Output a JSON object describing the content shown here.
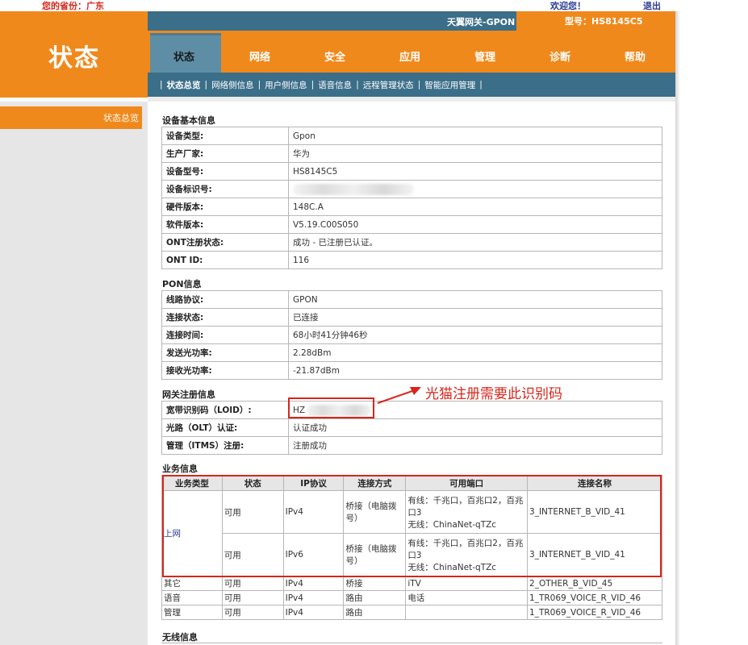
{
  "top": {
    "province_label": "您的省份：广东",
    "welcome": "欢迎您！",
    "logout": "退出"
  },
  "header": {
    "big_title": "状态",
    "gateway_name": "天翼网关-GPON",
    "model": "型号：HS8145C5"
  },
  "nav": {
    "tabs": [
      "状态",
      "网络",
      "安全",
      "应用",
      "管理",
      "诊断",
      "帮助"
    ],
    "active": "状态"
  },
  "subnav": {
    "items": [
      "状态总览",
      "网络侧信息",
      "用户侧信息",
      "语音信息",
      "远程管理状态",
      "智能应用管理"
    ],
    "active": "状态总览"
  },
  "sidebar": {
    "active_item": "状态总览"
  },
  "device": {
    "title": "设备基本信息",
    "rows": [
      {
        "k": "设备类型:",
        "v": "Gpon"
      },
      {
        "k": "生产厂家:",
        "v": "华为"
      },
      {
        "k": "设备型号:",
        "v": "HS8145C5"
      },
      {
        "k": "设备标识号:",
        "v": ""
      },
      {
        "k": "硬件版本:",
        "v": "148C.A"
      },
      {
        "k": "软件版本:",
        "v": "V5.19.C00S050"
      },
      {
        "k": "ONT注册状态:",
        "v": "成功 - 已注册已认证。"
      },
      {
        "k": "ONT ID:",
        "v": "116"
      }
    ]
  },
  "pon": {
    "title": "PON信息",
    "rows": [
      {
        "k": "线路协议:",
        "v": "GPON"
      },
      {
        "k": "连接状态:",
        "v": "已连接"
      },
      {
        "k": "连接时间:",
        "v": "68小时41分钟46秒"
      },
      {
        "k": "发送光功率:",
        "v": "2.28dBm"
      },
      {
        "k": "接收光功率:",
        "v": "-21.87dBm"
      }
    ]
  },
  "gw": {
    "title": "网关注册信息",
    "rows": [
      {
        "k": "宽带识别码（LOID）:",
        "v": "HZ"
      },
      {
        "k": "光路（OLT）认证:",
        "v": "认证成功"
      },
      {
        "k": "管理（ITMS）注册:",
        "v": "注册成功"
      }
    ],
    "annotation": "光猫注册需要此识别码"
  },
  "service": {
    "title": "业务信息",
    "headers": [
      "业务类型",
      "状态",
      "IP协议",
      "连接方式",
      "可用端口",
      "连接名称"
    ],
    "internet_label": "上网",
    "internet_rows": [
      {
        "status": "可用",
        "ip": "IPv4",
        "mode": "桥接（电脑拨号）",
        "port1": "有线：千兆口，百兆口2，百兆口3",
        "port2": "无线：ChinaNet-qTZc",
        "name": "3_INTERNET_B_VID_41"
      },
      {
        "status": "可用",
        "ip": "IPv6",
        "mode": "桥接（电脑拨号）",
        "port1": "有线：千兆口，百兆口2，百兆口3",
        "port2": "无线：ChinaNet-qTZc",
        "name": "3_INTERNET_B_VID_41"
      }
    ],
    "other_rows": [
      {
        "type": "其它",
        "status": "可用",
        "ip": "IPv4",
        "mode": "桥接",
        "port": "iTV",
        "name": "2_OTHER_B_VID_45"
      },
      {
        "type": "语音",
        "status": "可用",
        "ip": "IPv4",
        "mode": "路由",
        "port": "电话",
        "name": "1_TR069_VOICE_R_VID_46"
      },
      {
        "type": "管理",
        "status": "可用",
        "ip": "IPv4",
        "mode": "路由",
        "port": "",
        "name": "1_TR069_VOICE_R_VID_46"
      }
    ]
  },
  "wireless": {
    "title": "无线信息"
  }
}
